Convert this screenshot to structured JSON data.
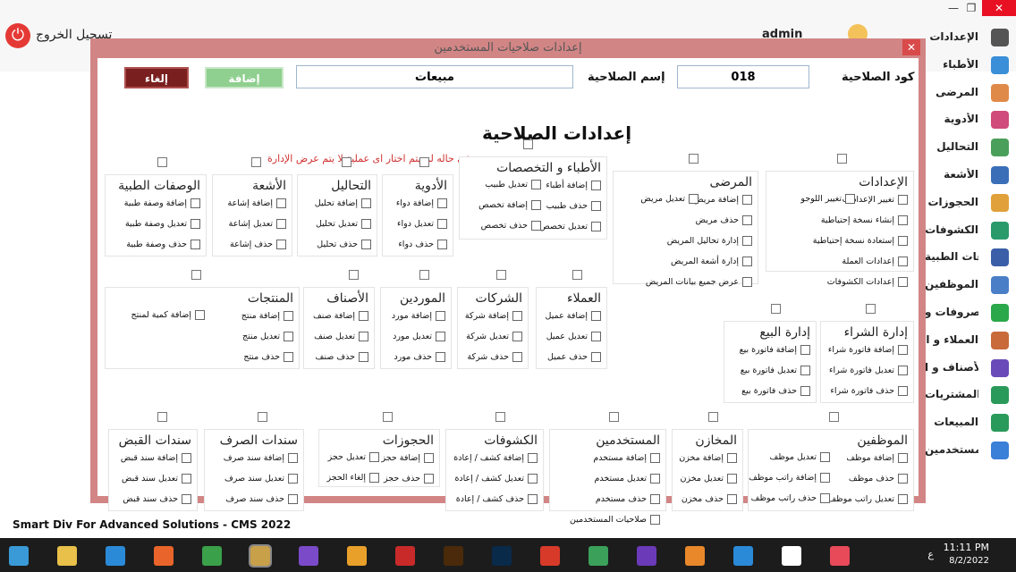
{
  "window": {
    "restore_glyph": "❐",
    "close_glyph": "✕"
  },
  "topbar": {
    "logout_label": "تسجيل الخروج",
    "user_label": "admin"
  },
  "sidenav": {
    "items": [
      {
        "label": "الإعدادات",
        "icon": "gear-icon",
        "color": "#555555"
      },
      {
        "label": "الأطباء",
        "icon": "doctor-icon",
        "color": "#3a8fd8"
      },
      {
        "label": "المرضى",
        "icon": "patient-icon",
        "color": "#e08a4a"
      },
      {
        "label": "الأدوية",
        "icon": "pill-icon",
        "color": "#d04a7a"
      },
      {
        "label": "التحاليل",
        "icon": "lab-icon",
        "color": "#4aa05a"
      },
      {
        "label": "الأشعة",
        "icon": "xray-icon",
        "color": "#3a6fb8"
      },
      {
        "label": "الحجوزات",
        "icon": "calendar-icon",
        "color": "#e0a03a"
      },
      {
        "label": "الكشوفات",
        "icon": "chart-icon",
        "color": "#2a9a6a"
      },
      {
        "label": "الوصفات الطبية",
        "icon": "prescription-icon",
        "color": "#3a5fa8"
      },
      {
        "label": "الموظفين",
        "icon": "employee-icon",
        "color": "#4a7fc8"
      },
      {
        "label": "المصروفات و",
        "icon": "money-icon",
        "color": "#2aa84a"
      },
      {
        "label": "العملاء و ا",
        "icon": "customers-icon",
        "color": "#c86a3a"
      },
      {
        "label": "الأصناف و ا",
        "icon": "items-icon",
        "color": "#6a4ab8"
      },
      {
        "label": "المشتريات",
        "icon": "cart-icon",
        "color": "#2a9a5a"
      },
      {
        "label": "المبيعات",
        "icon": "sales-cart-icon",
        "color": "#2a9a5a"
      },
      {
        "label": "المستخدمين",
        "icon": "users-icon",
        "color": "#3a7fd8"
      }
    ]
  },
  "footer": {
    "text": "Smart Div For Advanced Solutions - CMS 2022"
  },
  "dialog": {
    "title": "إعدادات صلاحيات المستخدمين",
    "close_glyph": "✕",
    "code_label": "كود الصلاحية",
    "code_value": "018",
    "name_label": "إسم الصلاحية",
    "name_value": "مبيعات",
    "add_button": "إضافة",
    "cancel_button": "إلغاء",
    "section_title": "إعدادات الصلاحية",
    "note": "فى حاله لم يتم اختار اى عملية لا يتم عرض الإدارة",
    "colors": {
      "frame": "#d28585",
      "cancel": "#7a1f1f",
      "add": "#8fcf8f",
      "note": "#d03030"
    }
  },
  "groups": [
    {
      "id": "settings",
      "title": "الإعدادات",
      "items": [
        "تغيير الإعدادات",
        "إنشاء نسخة إحتياطية",
        "إستعادة نسخة إحتياطية",
        "إعدادات العملة",
        "إعدادات الكشوفات"
      ]
    },
    {
      "id": "settings2",
      "title": "",
      "items": [
        "تغيير اللوجو"
      ]
    },
    {
      "id": "patients",
      "title": "المرضى",
      "items": [
        "إضافة مريض",
        "حذف مريض",
        "إدارة تحاليل المريض",
        "إدارة أشعة المريض",
        "عرض جميع بيانات المريض"
      ]
    },
    {
      "id": "patients2",
      "title": "",
      "items": [
        "تعديل مريض"
      ]
    },
    {
      "id": "doctors",
      "title": "الأطباء و التخصصات",
      "items": [
        "إضافة أطباء",
        "حذف طبيب",
        "تعديل تخصص"
      ]
    },
    {
      "id": "doctors2",
      "title": "",
      "items": [
        "تعديل طبيب",
        "إضافة تخصص",
        "حذف تخصص"
      ]
    },
    {
      "id": "medicine",
      "title": "الأدوية",
      "items": [
        "إضافة دواء",
        "تعديل دواء",
        "حذف دواء"
      ]
    },
    {
      "id": "tests",
      "title": "التحاليل",
      "items": [
        "إضافة تحليل",
        "تعديل تحليل",
        "حذف تحليل"
      ]
    },
    {
      "id": "xray",
      "title": "الأشعة",
      "items": [
        "إضافة إشاعة",
        "تعديل إشاعة",
        "حذف إشاعة"
      ]
    },
    {
      "id": "prescriptions",
      "title": "الوصفات الطبية",
      "items": [
        "إضافة وصفة طبية",
        "تعديل وصفة طبية",
        "حذف وصفة طبية"
      ]
    },
    {
      "id": "customers",
      "title": "العملاء",
      "items": [
        "إضافة عميل",
        "تعديل عميل",
        "حذف عميل"
      ]
    },
    {
      "id": "companies",
      "title": "الشركات",
      "items": [
        "إضافة شركة",
        "تعديل شركة",
        "حذف شركة"
      ]
    },
    {
      "id": "suppliers",
      "title": "الموردين",
      "items": [
        "إضافة مورد",
        "تعديل مورد",
        "حذف مورد"
      ]
    },
    {
      "id": "categories",
      "title": "الأصناف",
      "items": [
        "إضافة صنف",
        "تعديل صنف",
        "حذف صنف"
      ]
    },
    {
      "id": "products",
      "title": "المنتجات",
      "items": [
        "إضافة منتج",
        "تعديل منتج",
        "حذف منتج"
      ]
    },
    {
      "id": "products2",
      "title": "",
      "items": [
        "إضافة كمية لمنتج"
      ]
    },
    {
      "id": "purchases",
      "title": "إدارة الشراء",
      "items": [
        "إضافة فاتورة شراء",
        "تعديل فاتورة شراء",
        "حذف فاتورة شراء"
      ]
    },
    {
      "id": "sales",
      "title": "إدارة البيع",
      "items": [
        "إضافة فاتورة بيع",
        "تعديل فاتورة بيع",
        "حذف فاتورة بيع"
      ]
    },
    {
      "id": "employees",
      "title": "الموظفين",
      "items": [
        "إضافة موظف",
        "حذف موظف",
        "تعديل راتب موظف"
      ]
    },
    {
      "id": "employees2",
      "title": "",
      "items": [
        "تعديل موظف",
        "إضافة راتب موظف",
        "حذف راتب موظف"
      ]
    },
    {
      "id": "stores",
      "title": "المخازن",
      "items": [
        "إضافة مخزن",
        "تعديل مخزن",
        "حذف مخزن"
      ]
    },
    {
      "id": "users",
      "title": "المستخدمين",
      "items": [
        "إضافة مستخدم",
        "تعديل مستخدم",
        "حذف مستخدم",
        "صلاحيات المستخدمين"
      ]
    },
    {
      "id": "exams",
      "title": "الكشوفات",
      "items": [
        "إضافة كشف / إعادة",
        "تعديل كشف / إعادة",
        "حذف كشف / إعادة"
      ]
    },
    {
      "id": "bookings",
      "title": "الحجوزات",
      "items": [
        "إضافة حجز",
        "حذف حجز"
      ]
    },
    {
      "id": "bookings2",
      "title": "",
      "items": [
        "تعديل حجز",
        "إلغاء الحجز"
      ]
    },
    {
      "id": "payments",
      "title": "سندات الصرف",
      "items": [
        "إضافة سند صرف",
        "تعديل سند صرف",
        "حذف سند صرف"
      ]
    },
    {
      "id": "receipts",
      "title": "سندات القبض",
      "items": [
        "إضافة سند قبض",
        "تعديل سند قبض",
        "حذف سند قبض"
      ]
    }
  ],
  "taskbar": {
    "time": "11:11 PM",
    "date": "8/2/2022",
    "lang": "ع",
    "apps": [
      {
        "name": "start-icon",
        "color": "#3a9ad8"
      },
      {
        "name": "file-explorer-icon",
        "color": "#e8c04a"
      },
      {
        "name": "edge-icon",
        "color": "#2a8ad8"
      },
      {
        "name": "firefox-icon",
        "color": "#e8642a"
      },
      {
        "name": "calculator-icon",
        "color": "#3aa04a"
      },
      {
        "name": "tools-icon",
        "color": "#c8a04a"
      },
      {
        "name": "visual-studio-icon",
        "color": "#7a4ac8"
      },
      {
        "name": "media-player-icon",
        "color": "#e8a02a"
      },
      {
        "name": "filezilla-icon",
        "color": "#c82a2a"
      },
      {
        "name": "illustrator-icon",
        "color": "#4a2a0a"
      },
      {
        "name": "photoshop-icon",
        "color": "#0a2a4a"
      },
      {
        "name": "anydesk-icon",
        "color": "#d83a2a"
      },
      {
        "name": "android-studio-icon",
        "color": "#3aa05a"
      },
      {
        "name": "vs-2022-icon",
        "color": "#6a3ab8"
      },
      {
        "name": "blender-icon",
        "color": "#e8882a"
      },
      {
        "name": "vscode-icon",
        "color": "#2a8ad8"
      },
      {
        "name": "capcut-icon",
        "color": "#ffffff"
      },
      {
        "name": "clinic-app-icon",
        "color": "#e84a5a"
      }
    ]
  }
}
